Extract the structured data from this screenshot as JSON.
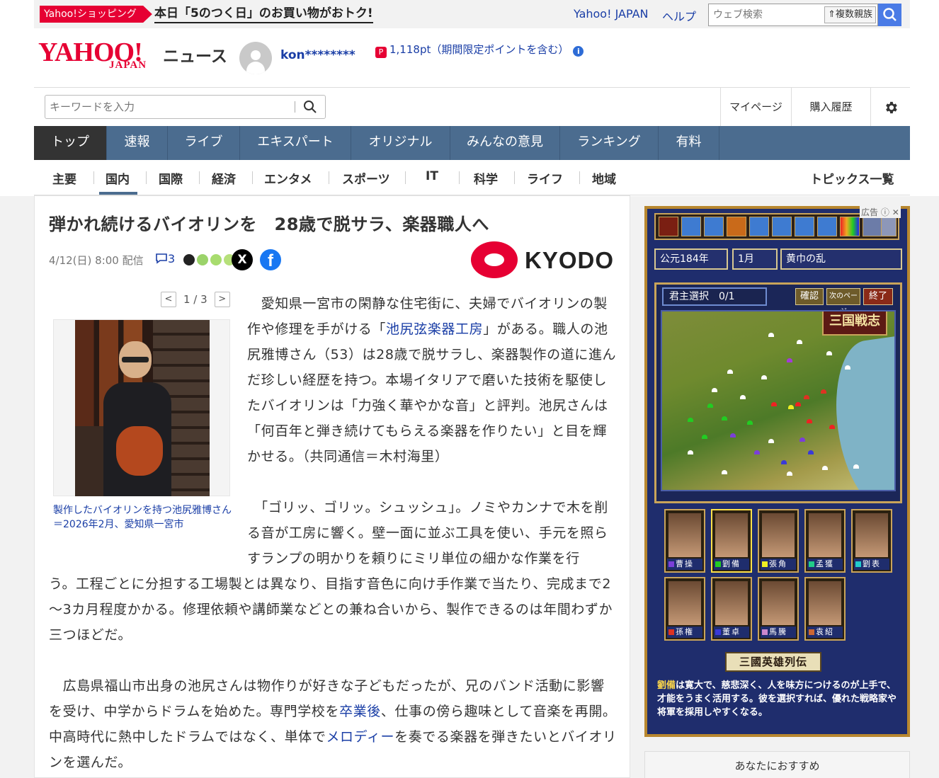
{
  "topbar": {
    "promo_tag": "Yahoo!ショッピング",
    "promo_text": "本日「5のつく日」のお買い物がおトク!",
    "links": [
      "Yahoo! JAPAN",
      "ヘルプ"
    ],
    "web_search_placeholder": "ウェブ検索",
    "kids_button": "複数親族"
  },
  "header": {
    "logo_main": "YAHOO!",
    "logo_sub": "JAPAN",
    "logo_section": "ニュース",
    "username": "kon********",
    "points": "1,118pt（期間限定ポイントを含む）"
  },
  "searchbar": {
    "placeholder": "キーワードを入力",
    "links": [
      "マイページ",
      "購入履歴"
    ]
  },
  "main_nav": [
    "トップ",
    "速報",
    "ライブ",
    "エキスパート",
    "オリジナル",
    "みんなの意見",
    "ランキング",
    "有料"
  ],
  "sub_nav": [
    "主要",
    "国内",
    "国際",
    "経済",
    "エンタメ",
    "スポーツ",
    "IT",
    "科学",
    "ライフ",
    "地域"
  ],
  "sub_nav_active": "国内",
  "topics_link": "トピックス一覧",
  "article": {
    "headline": "弾かれ続けるバイオリンを　28歳で脱サラ、楽器職人へ",
    "date": "4/12(日) 8:00 配信",
    "comment_count": "3",
    "x_label": "X",
    "fb_label": "f",
    "source_logo": "KYODO",
    "pager": "1 / 3",
    "caption": "製作したバイオリンを持つ池尻雅博さん＝2026年2月、愛知県一宮市",
    "p1_a": "　愛知県一宮市の閑静な住宅街に、夫婦でバイオリンの製作や修理を手がける「",
    "p1_link": "池尻弦楽器工房",
    "p1_b": "」がある。職人の池尻雅博さん（53）は28歳で脱サラし、楽器製作の道に進んだ珍しい経歴を持つ。本場イタリアで磨いた技術を駆使したバイオリンは「力強く華やかな音」と評判。池尻さんは「何百年と弾き続けてもらえる楽器を作りたい」と目を輝かせる。（共同通信＝木村海里）",
    "p2_top": "　「ゴリッ、ゴリッ。シュッシュ」。ノミやカンナで木を削る音が工房に響く。壁一面に並ぶ工具を使い、手元を照らすランプの明かりを頼りにミリ単位の細かな作業を行",
    "p2_rest": "う。工程ごとに分担する工場製とは異なり、目指す音色に向け手作業で当たり、完成まで2～3カ月程度かかる。修理依頼や講師業などとの兼ね合いから、製作できるのは年間わずか三つほどだ。",
    "p3_a": "　広島県福山市出身の池尻さんは物作りが好きな子どもだったが、兄のバンド活動に影響を受け、中学からドラムを始めた。専門学校を",
    "p3_link1": "卒業後",
    "p3_b": "、仕事の傍ら趣味として音楽を再開。中高時代に熱中したドラムではなく、単体で",
    "p3_link2": "メロディー",
    "p3_c": "を奏でる楽器を弾きたいとバイオリンを選んだ。"
  },
  "ad": {
    "label": "広告",
    "era": "公元184年",
    "month": "1月",
    "event": "黄巾の乱",
    "select": "君主選択　0/1",
    "btn_confirm": "確認",
    "btn_next": "次のページ",
    "btn_end": "終了",
    "title": "三国戦志",
    "lords": [
      "曹操",
      "劉備",
      "張角",
      "孟獲",
      "劉表",
      "孫権",
      "董卓",
      "馬騰",
      "袁紹"
    ],
    "heroes_button": "三國英雄列伝",
    "desc_name": "劉備",
    "desc_text": "は寛大で、慈悲深く、人を味方につけるのが上手で、才能をうまく活用する。彼を選択すれば、優れた戦略家や将軍を採用しやすくなる。"
  },
  "recommend": "あなたにおすすめ",
  "colors": {
    "brand_red": "#e60033",
    "link_blue": "#1a3ea6",
    "nav_blue": "#4b6c8f"
  }
}
